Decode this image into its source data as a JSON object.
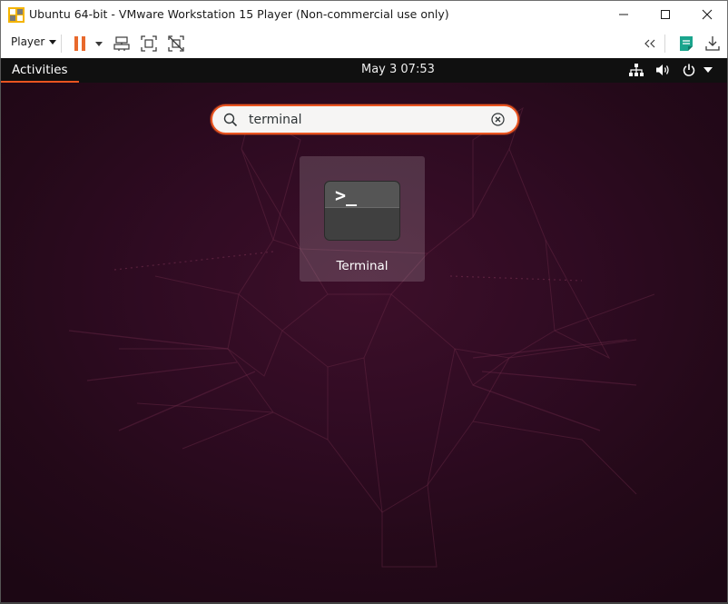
{
  "window": {
    "title": "Ubuntu 64-bit - VMware Workstation 15 Player (Non-commercial use only)",
    "icon": "vmware-player-icon",
    "controls": [
      "minimize-icon",
      "maximize-icon",
      "close-icon"
    ]
  },
  "toolbar": {
    "player_label": "Player",
    "icons": [
      "pause-icon",
      "dropdown-icon",
      "send-ctrl-alt-del-icon",
      "fullscreen-icon",
      "unity-icon",
      "collapse-icon",
      "notes-icon",
      "download-icon"
    ],
    "colors": {
      "pause": "#e8692c",
      "notes": "#1aa58d"
    }
  },
  "topbar": {
    "activities_label": "Activities",
    "clock": "May 3  07:53",
    "status_icons": [
      "network-icon",
      "volume-icon",
      "power-icon",
      "chevron-down-icon"
    ]
  },
  "search": {
    "query": "terminal",
    "icon": "search-icon",
    "clear_icon": "clear-icon"
  },
  "results": [
    {
      "name": "Terminal",
      "icon": "terminal-app-icon",
      "prompt": ">_"
    }
  ],
  "colors": {
    "accent": "#e95420",
    "background": "#2c0a20",
    "topbar": "#101010"
  }
}
